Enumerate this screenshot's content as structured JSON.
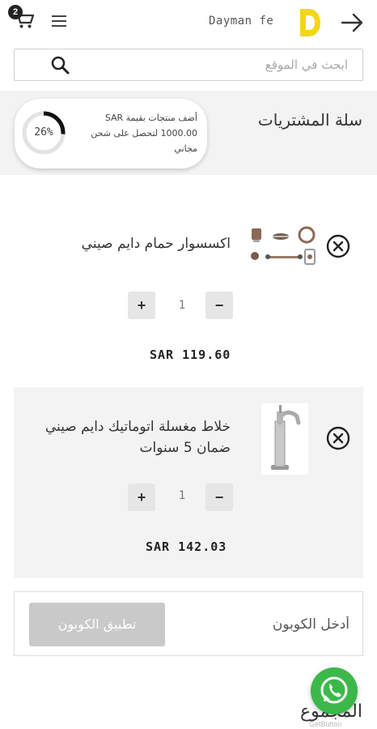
{
  "header": {
    "cart_count": "2",
    "brand_name": "Dayman fe",
    "icons": [
      "cart-icon",
      "menu-icon",
      "logo-d-icon",
      "back-arrow-icon"
    ],
    "accent_color": "#f5d51c"
  },
  "search": {
    "placeholder": "ابحث في الموقع"
  },
  "cart": {
    "title": "سلة المشتريات",
    "promo": {
      "text": "أضف منتجات بقيمة SAR 1000.00 لتحصل على شحن مجاني",
      "progress_label": "26%",
      "progress_fraction": 0.26
    },
    "items": [
      {
        "name": "اكسسوار حمام دايم صيني",
        "quantity": "1",
        "minus": "−",
        "plus": "+",
        "price": "SAR 119.60"
      },
      {
        "name": "خلاط مغسلة اتوماتيك دايم صيني ضمان 5 سنوات",
        "quantity": "1",
        "minus": "−",
        "plus": "+",
        "price": "SAR 142.03"
      }
    ]
  },
  "coupon": {
    "placeholder": "أدخل الكوبون",
    "apply_label": "تطبيق الكوبون"
  },
  "total": {
    "label": "المجموع"
  },
  "whatsapp": {
    "credit": "GetButton",
    "color": "#3cb84a"
  }
}
